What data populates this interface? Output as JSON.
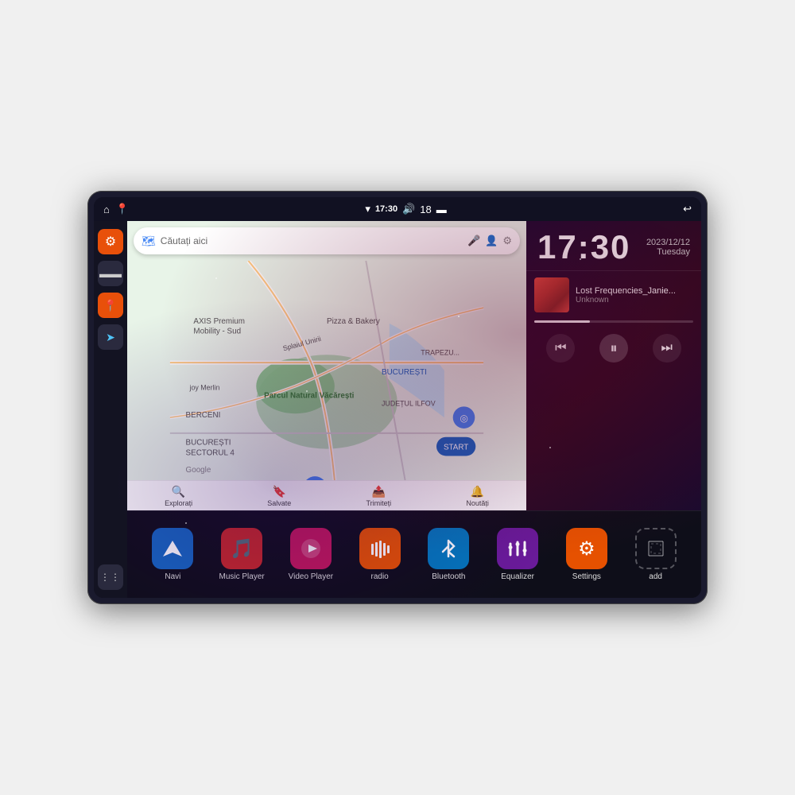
{
  "device": {
    "status_bar": {
      "wifi_icon": "▾",
      "time": "17:30",
      "volume_icon": "🔊",
      "battery_num": "18",
      "battery_icon": "🔋",
      "back_icon": "↩"
    },
    "sidebar": {
      "settings_icon": "⚙",
      "files_icon": "📁",
      "maps_icon": "📍",
      "navigation_icon": "➤",
      "apps_icon": "⋮⋮⋮"
    },
    "map": {
      "search_placeholder": "Căutați aici",
      "toolbar_items": [
        {
          "icon": "📍",
          "label": "Explorați"
        },
        {
          "icon": "🔖",
          "label": "Salvate"
        },
        {
          "icon": "📤",
          "label": "Trimiteți"
        },
        {
          "icon": "🔔",
          "label": "Noutăți"
        }
      ]
    },
    "clock": {
      "time": "17:30",
      "date": "2023/12/12",
      "day": "Tuesday"
    },
    "music": {
      "title": "Lost Frequencies_Janie...",
      "artist": "Unknown",
      "progress": 35
    },
    "apps": [
      {
        "id": "navi",
        "label": "Navi",
        "icon": "➤",
        "color": "blue"
      },
      {
        "id": "music-player",
        "label": "Music Player",
        "icon": "🎵",
        "color": "red"
      },
      {
        "id": "video-player",
        "label": "Video Player",
        "icon": "▶",
        "color": "pink"
      },
      {
        "id": "radio",
        "label": "radio",
        "icon": "📻",
        "color": "orange"
      },
      {
        "id": "bluetooth",
        "label": "Bluetooth",
        "icon": "⚡",
        "color": "ltblue"
      },
      {
        "id": "equalizer",
        "label": "Equalizer",
        "icon": "🎚",
        "color": "purple"
      },
      {
        "id": "settings",
        "label": "Settings",
        "icon": "⚙",
        "color": "darkorange"
      },
      {
        "id": "add",
        "label": "add",
        "icon": "+",
        "color": "ghost"
      }
    ]
  }
}
